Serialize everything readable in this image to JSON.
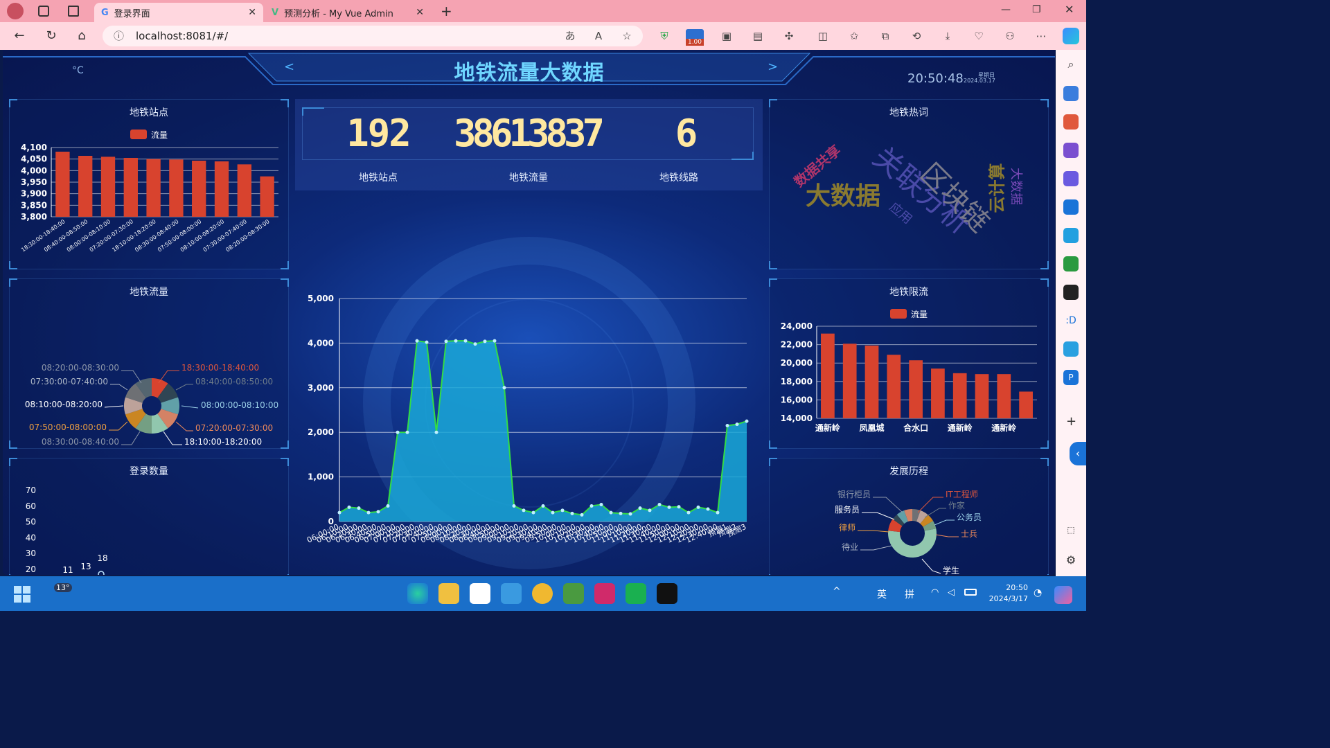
{
  "browser": {
    "tabs": [
      {
        "label": "登录界面",
        "active": true
      },
      {
        "label": "预测分析 - My Vue Admin",
        "active": false
      }
    ],
    "url": "localhost:8081/#/",
    "zoom_badge": "1.00"
  },
  "dashboard": {
    "title": "地铁流量大数据",
    "temperature": "°C",
    "time": "20:50:48",
    "weekday": "星期日",
    "date": "2024.03.17",
    "nav_left": "<",
    "nav_right": ">",
    "stats": [
      {
        "value": "192",
        "label": "地铁站点"
      },
      {
        "value": "38613837",
        "label": "地铁流量"
      },
      {
        "value": "6",
        "label": "地铁线路"
      }
    ],
    "panels": {
      "stations": {
        "title": "地铁站点",
        "legend": "流量"
      },
      "flow": {
        "title": "地铁流量"
      },
      "logins": {
        "title": "登录数量"
      },
      "hotwords": {
        "title": "地铁热词",
        "words": [
          "数据共享",
          "大数据",
          "关联分析",
          "区块链",
          "云计算",
          "大数据",
          "应用"
        ]
      },
      "limit": {
        "title": "地铁限流",
        "legend": "流量"
      },
      "history": {
        "title": "发展历程"
      }
    }
  },
  "chart_data": [
    {
      "type": "bar",
      "title": "地铁站点",
      "legend": [
        "流量"
      ],
      "categories": [
        "18:30:00-18:40:00",
        "08:40:00-08:50:00",
        "08:00:00-08:10:00",
        "07:20:00-07:30:00",
        "18:10:00-18:20:00",
        "08:30:00-08:40:00",
        "07:50:00-08:00:00",
        "08:10:00-08:20:00",
        "07:30:00-07:40:00",
        "08:20:00-08:30:00"
      ],
      "values": [
        4082,
        4064,
        4060,
        4055,
        4050,
        4048,
        4043,
        4040,
        4027,
        3975
      ],
      "ylim": [
        3800,
        4100
      ],
      "yticks": [
        "4,100",
        "4,050",
        "4,000",
        "3,950",
        "3,900",
        "3,850",
        "3,800"
      ],
      "color": "#d8432e"
    },
    {
      "type": "pie",
      "title": "地铁流量",
      "labels": [
        "18:30:00-18:40:00",
        "08:40:00-08:50:00",
        "08:00:00-08:10:00",
        "07:20:00-07:30:00",
        "18:10:00-18:20:00",
        "08:30:00-08:40:00",
        "07:50:00-08:00:00",
        "08:10:00-08:20:00",
        "07:30:00-07:40:00",
        "08:20:00-08:30:00"
      ],
      "label_colors": [
        "#e0563c",
        "#6e7c8a",
        "#9bd0e8",
        "#f08a5a",
        "#ffffff",
        "#8c96a8",
        "#f0a040",
        "#ffffff",
        "#aab4c4",
        "#8c96a8"
      ],
      "slice_colors": [
        "#d8432e",
        "#2f4554",
        "#61a0a8",
        "#d48265",
        "#91c7ae",
        "#749f83",
        "#ca8622",
        "#bda29a",
        "#6e7074",
        "#546570"
      ],
      "values": [
        10,
        10,
        10,
        10,
        10,
        10,
        10,
        10,
        10,
        10
      ]
    },
    {
      "type": "area",
      "title": "",
      "yticks": [
        "5,000",
        "4,000",
        "3,000",
        "2,000",
        "1,000",
        "0"
      ],
      "ylim": [
        0,
        5000
      ],
      "x": [
        "06:00:00",
        "06:10:00",
        "06:20:00",
        "06:30:00",
        "06:40:00",
        "06:50:00",
        "07:00:00",
        "07:10:00",
        "07:20:00",
        "07:30:00",
        "07:40:00",
        "07:50:00",
        "08:00:00",
        "08:10:00",
        "08:20:00",
        "08:30:00",
        "08:40:00",
        "08:50:00",
        "09:00:00",
        "09:10:00",
        "09:20:00",
        "09:30:00",
        "09:40:00",
        "09:50:00",
        "10:00:00",
        "10:10:00",
        "10:20:00",
        "10:30:00",
        "10:40:00",
        "10:50:00",
        "11:00:00",
        "11:10:00",
        "11:20:00",
        "11:30:00",
        "11:40:00",
        "11:50:00",
        "12:00:00",
        "12:10:00",
        "12:20:00",
        "12:30:00",
        "12:40:00",
        "预测1",
        "预测2",
        "预测3"
      ],
      "values": [
        200,
        320,
        300,
        200,
        220,
        350,
        2000,
        2000,
        4050,
        4020,
        2000,
        4040,
        4050,
        4050,
        3980,
        4040,
        4050,
        3000,
        350,
        250,
        200,
        350,
        200,
        250,
        180,
        150,
        350,
        380,
        200,
        180,
        170,
        300,
        250,
        380,
        320,
        330,
        200,
        320,
        280,
        200,
        2150,
        2180,
        2250
      ],
      "fill": "#1aa8d8",
      "line": "#33dd44"
    },
    {
      "type": "bar",
      "title": "地铁限流",
      "legend": [
        "流量"
      ],
      "categories": [
        "通新岭",
        "凤凰城",
        "合水口",
        "通新岭",
        "通新岭"
      ],
      "values": [
        23200,
        22100,
        21900,
        20900,
        20300,
        19400,
        18900,
        18800,
        18800,
        16900
      ],
      "ylim": [
        14000,
        24000
      ],
      "yticks": [
        "24,000",
        "22,000",
        "20,000",
        "18,000",
        "16,000",
        "14,000"
      ],
      "color": "#d8432e"
    },
    {
      "type": "bar",
      "title": "登录数量",
      "yticks": [
        "70",
        "60",
        "50",
        "40",
        "30",
        "20"
      ],
      "ylim": [
        20,
        70
      ],
      "data_labels": [
        "11",
        "13",
        "18"
      ]
    },
    {
      "type": "pie",
      "title": "发展历程",
      "labels": [
        "银行柜员",
        "服务员",
        "律师",
        "待业",
        "学生",
        "IT工程师",
        "作家",
        "公务员",
        "士兵"
      ],
      "label_colors": [
        "#8c96a8",
        "#ffffff",
        "#f0a040",
        "#aab4c4",
        "#ffffff",
        "#e0563c",
        "#6e7c8a",
        "#9bd0e8",
        "#f08a5a"
      ],
      "slice_colors": [
        "#6e7074",
        "#bda29a",
        "#ca8622",
        "#749f83",
        "#91c7ae",
        "#d8432e",
        "#2f4554",
        "#61a0a8",
        "#d48265"
      ],
      "values": [
        4,
        4,
        4,
        4,
        40,
        6,
        3,
        4,
        4
      ]
    }
  ],
  "taskbar": {
    "weather": "13°",
    "ime1": "英",
    "ime2": "拼",
    "time": "20:50",
    "date": "2024/3/17"
  }
}
